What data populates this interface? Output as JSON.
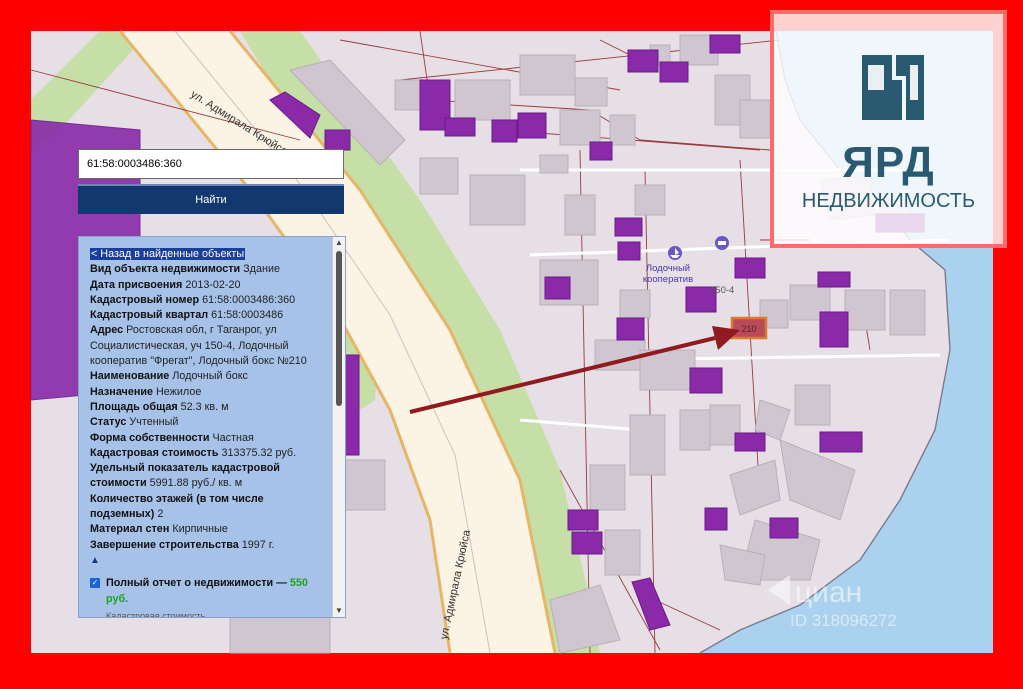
{
  "search": {
    "value": "61:58:0003486:360",
    "button_label": "Найти"
  },
  "panel": {
    "back_link": "< Назад в найденные объекты",
    "fields": [
      {
        "label": "Вид объекта недвижимости",
        "value": "Здание"
      },
      {
        "label": "Дата присвоения",
        "value": "2013-02-20"
      },
      {
        "label": "Кадастровый номер",
        "value": "61:58:0003486:360"
      },
      {
        "label": "Кадастровый квартал",
        "value": "61:58:0003486"
      },
      {
        "label": "Адрес",
        "value": "Ростовская обл, г Таганрог, ул Социалистическая, уч 150-4, Лодочный кооператив \"Фрегат\", Лодочный бокс №210"
      },
      {
        "label": "Наименование",
        "value": "Лодочный бокс"
      },
      {
        "label": "Назначение",
        "value": "Нежилое"
      },
      {
        "label": "Площадь общая",
        "value": "52.3 кв. м"
      },
      {
        "label": "Статус",
        "value": "Учтенный"
      },
      {
        "label": "Форма собственности",
        "value": "Частная"
      },
      {
        "label": "Кадастровая стоимость",
        "value": "313375.32 руб."
      },
      {
        "label": "Удельный показатель кадастровой стоимости",
        "value": "5991.88 руб./ кв. м"
      },
      {
        "label": "Количество этажей (в том числе подземных)",
        "value": "2"
      },
      {
        "label": "Материал стен",
        "value": "Кирпичные"
      },
      {
        "label": "Завершение строительства",
        "value": "1997 г."
      }
    ],
    "collapse_marker": "▲",
    "report_label": "Полный отчет о недвижимости — ",
    "report_price": "550 руб.",
    "cut_text": "Кадастровая стоимость"
  },
  "map": {
    "street_top": "ул. Адмирала Крюйса",
    "street_bottom": "ул. Адмирала Крюйса",
    "poi_label_line1": "Лодочный",
    "poi_label_line2": "кооператив",
    "house_number": "150-4",
    "highlighted_label": "210",
    "colors": {
      "land": "#e6dfe6",
      "building": "#cfc6cf",
      "building_edge": "#b9b0b9",
      "road": "#fbf3e4",
      "road_edge": "#e6b566",
      "green": "#c5dfa6",
      "water": "#aad2ee",
      "cadastral": "#7e1e9e",
      "boundary": "#9b3a3a",
      "arrow": "#8f1a20",
      "highlight": "#e07a2a"
    }
  },
  "logo": {
    "name": "ЯРД",
    "sub": "НЕДВИЖИМОСТЬ"
  },
  "watermark": {
    "brand": "циан",
    "id": "ID 318096272"
  }
}
